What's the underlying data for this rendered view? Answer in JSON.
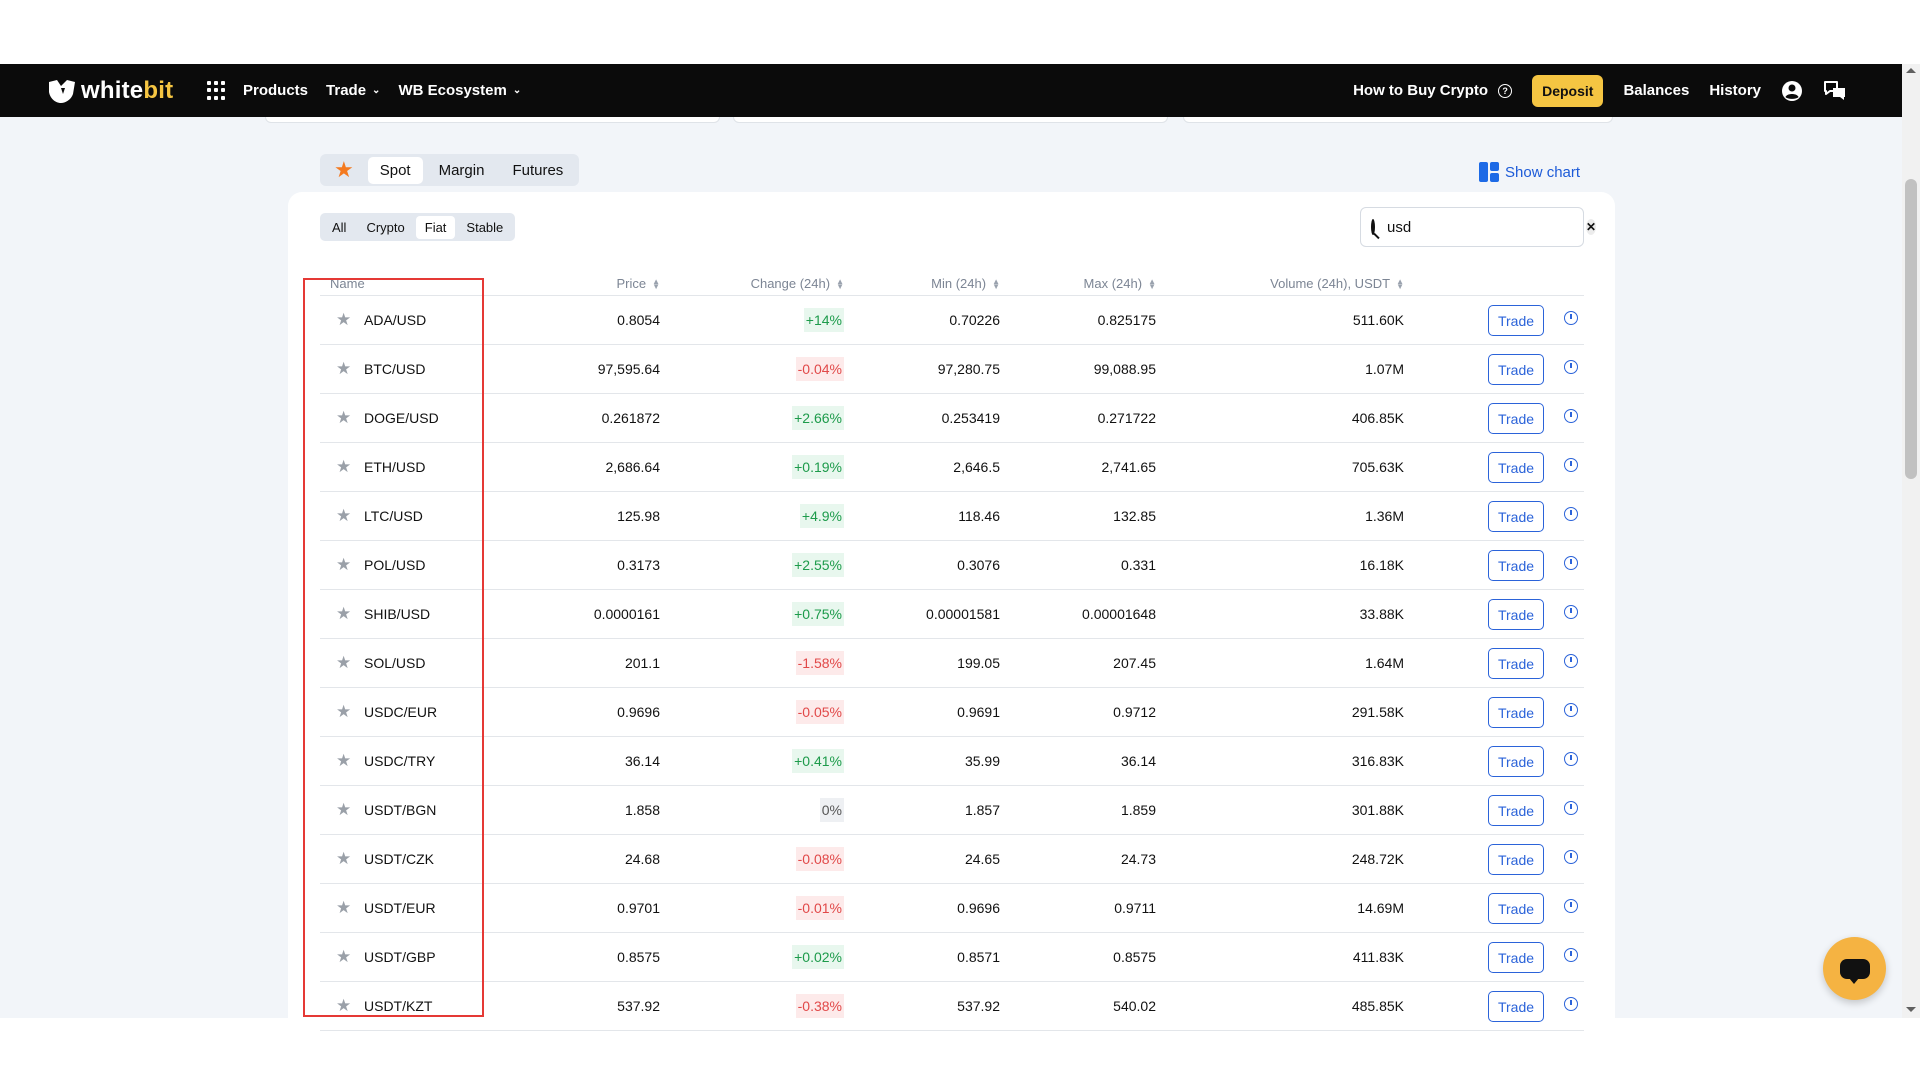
{
  "nav": {
    "logo_white": "white",
    "logo_bit": "bit",
    "products": "Products",
    "trade": "Trade",
    "ecosystem": "WB Ecosystem",
    "how_to_buy": "How to Buy Crypto",
    "deposit": "Deposit",
    "balances": "Balances",
    "history": "History"
  },
  "market_tabs": [
    "Spot",
    "Margin",
    "Futures"
  ],
  "active_market_tab": "Spot",
  "show_chart": "Show chart",
  "filter_tabs": [
    "All",
    "Crypto",
    "Fiat",
    "Stable"
  ],
  "active_filter": "Fiat",
  "search": {
    "value": "usd"
  },
  "table": {
    "headers": {
      "name": "Name",
      "price": "Price",
      "change": "Change (24h)",
      "min": "Min (24h)",
      "max": "Max (24h)",
      "volume": "Volume (24h), USDT"
    },
    "trade_label": "Trade",
    "rows": [
      {
        "pair": "ADA/USD",
        "price": "0.8054",
        "change": "+14%",
        "dir": "up",
        "min": "0.70226",
        "max": "0.825175",
        "volume": "511.60K"
      },
      {
        "pair": "BTC/USD",
        "price": "97,595.64",
        "change": "-0.04%",
        "dir": "down",
        "min": "97,280.75",
        "max": "99,088.95",
        "volume": "1.07M"
      },
      {
        "pair": "DOGE/USD",
        "price": "0.261872",
        "change": "+2.66%",
        "dir": "up",
        "min": "0.253419",
        "max": "0.271722",
        "volume": "406.85K"
      },
      {
        "pair": "ETH/USD",
        "price": "2,686.64",
        "change": "+0.19%",
        "dir": "up",
        "min": "2,646.5",
        "max": "2,741.65",
        "volume": "705.63K"
      },
      {
        "pair": "LTC/USD",
        "price": "125.98",
        "change": "+4.9%",
        "dir": "up",
        "min": "118.46",
        "max": "132.85",
        "volume": "1.36M"
      },
      {
        "pair": "POL/USD",
        "price": "0.3173",
        "change": "+2.55%",
        "dir": "up",
        "min": "0.3076",
        "max": "0.331",
        "volume": "16.18K"
      },
      {
        "pair": "SHIB/USD",
        "price": "0.0000161",
        "change": "+0.75%",
        "dir": "up",
        "min": "0.00001581",
        "max": "0.00001648",
        "volume": "33.88K"
      },
      {
        "pair": "SOL/USD",
        "price": "201.1",
        "change": "-1.58%",
        "dir": "down",
        "min": "199.05",
        "max": "207.45",
        "volume": "1.64M"
      },
      {
        "pair": "USDC/EUR",
        "price": "0.9696",
        "change": "-0.05%",
        "dir": "down",
        "min": "0.9691",
        "max": "0.9712",
        "volume": "291.58K"
      },
      {
        "pair": "USDC/TRY",
        "price": "36.14",
        "change": "+0.41%",
        "dir": "up",
        "min": "35.99",
        "max": "36.14",
        "volume": "316.83K"
      },
      {
        "pair": "USDT/BGN",
        "price": "1.858",
        "change": "0%",
        "dir": "flat",
        "min": "1.857",
        "max": "1.859",
        "volume": "301.88K"
      },
      {
        "pair": "USDT/CZK",
        "price": "24.68",
        "change": "-0.08%",
        "dir": "down",
        "min": "24.65",
        "max": "24.73",
        "volume": "248.72K"
      },
      {
        "pair": "USDT/EUR",
        "price": "0.9701",
        "change": "-0.01%",
        "dir": "down",
        "min": "0.9696",
        "max": "0.9711",
        "volume": "14.69M"
      },
      {
        "pair": "USDT/GBP",
        "price": "0.8575",
        "change": "+0.02%",
        "dir": "up",
        "min": "0.8571",
        "max": "0.8575",
        "volume": "411.83K"
      },
      {
        "pair": "USDT/KZT",
        "price": "537.92",
        "change": "-0.38%",
        "dir": "down",
        "min": "537.92",
        "max": "540.02",
        "volume": "485.85K"
      }
    ]
  },
  "colors": {
    "accent": "#f5c542",
    "link": "#2b63d9",
    "up": "#1d9b4b",
    "down": "#e14949",
    "highlight": "#e53935"
  }
}
